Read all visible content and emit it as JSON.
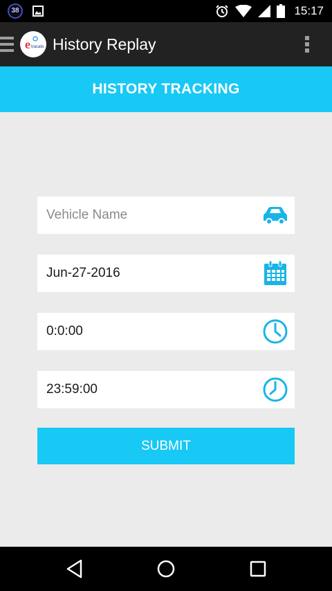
{
  "status_bar": {
    "notification_count": "38",
    "time": "15:17",
    "icons": [
      "image-icon",
      "alarm-icon",
      "wifi-icon",
      "signal-icon",
      "battery-icon"
    ]
  },
  "toolbar": {
    "title": "History Replay",
    "logo_text": "e",
    "logo_subtext": "tracato",
    "menu_icon": "hamburger-icon",
    "overflow_icon": "more-vert-icon"
  },
  "header": {
    "title": "HISTORY TRACKING"
  },
  "form": {
    "vehicle": {
      "placeholder": "Vehicle Name",
      "value": "",
      "icon": "car-icon"
    },
    "date": {
      "value": "Jun-27-2016",
      "icon": "calendar-icon"
    },
    "start_time": {
      "value": "0:0:00",
      "icon": "clock-icon"
    },
    "end_time": {
      "value": "23:59:00",
      "icon": "clock-icon"
    },
    "submit_label": "SUBMIT"
  },
  "nav_bar": {
    "icons": [
      "back-icon",
      "home-icon",
      "recents-icon"
    ]
  },
  "colors": {
    "accent": "#18c8f5",
    "toolbar": "#222222",
    "background": "#ebebeb"
  }
}
